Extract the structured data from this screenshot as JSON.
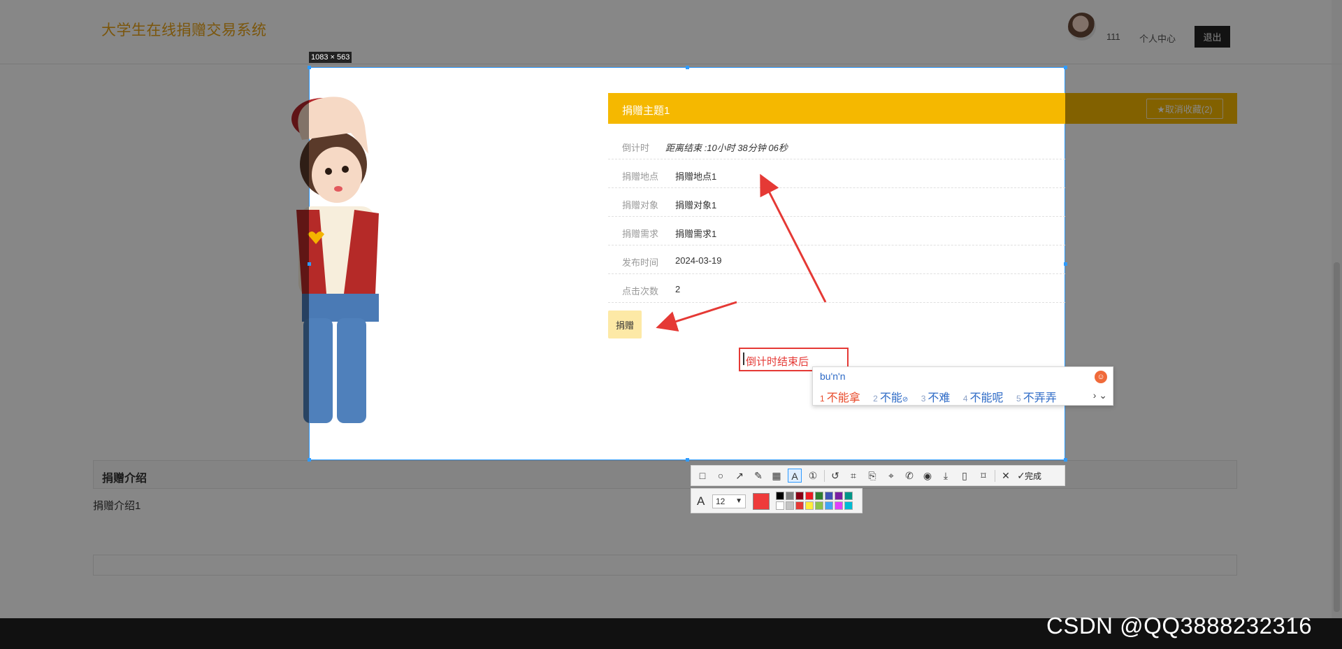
{
  "site": {
    "title": "大学生在线捐赠交易系统",
    "user_name": "111",
    "user_center": "个人中心",
    "logout": "退出"
  },
  "detail": {
    "title": "捐赠主题1",
    "favorite_button": "★取消收藏(2)",
    "rows": [
      {
        "label": "倒计时",
        "value": "距离结束 :10小时 38分钟 06秒"
      },
      {
        "label": "捐赠地点",
        "value": "捐赠地点1"
      },
      {
        "label": "捐赠对象",
        "value": "捐赠对象1"
      },
      {
        "label": "捐赠需求",
        "value": "捐赠需求1"
      },
      {
        "label": "发布时间",
        "value": "2024-03-19"
      },
      {
        "label": "点击次数",
        "value": "2"
      }
    ],
    "donate_button": "捐赠"
  },
  "intro": {
    "heading": "捐赠介绍",
    "text": "捐赠介绍1"
  },
  "screenshot_tool": {
    "size_label": "1083 × 563",
    "annotation_text": "倒计时结束后",
    "ime": {
      "input": "bu'n'n",
      "candidates": [
        {
          "num": "1",
          "text": "不能拿"
        },
        {
          "num": "2",
          "text": "不能"
        },
        {
          "num": "3",
          "text": "不难"
        },
        {
          "num": "4",
          "text": "不能呢"
        },
        {
          "num": "5",
          "text": "不弄弄"
        }
      ]
    },
    "done_label": "完成",
    "font_size": "12",
    "current_color": "#ee3b3b",
    "palette": [
      "#000000",
      "#7f7f7f",
      "#880015",
      "#ed1c24",
      "#2e7d32",
      "#3f51b5",
      "#7b1fa2",
      "#009688",
      "#ffffff",
      "#c3c3c3",
      "#e53935",
      "#ffeb3b",
      "#8bc34a",
      "#42a5f5",
      "#e040fb",
      "#00bcd4"
    ]
  },
  "accent": "#f5b800",
  "watermark": "CSDN @QQ3888232316"
}
